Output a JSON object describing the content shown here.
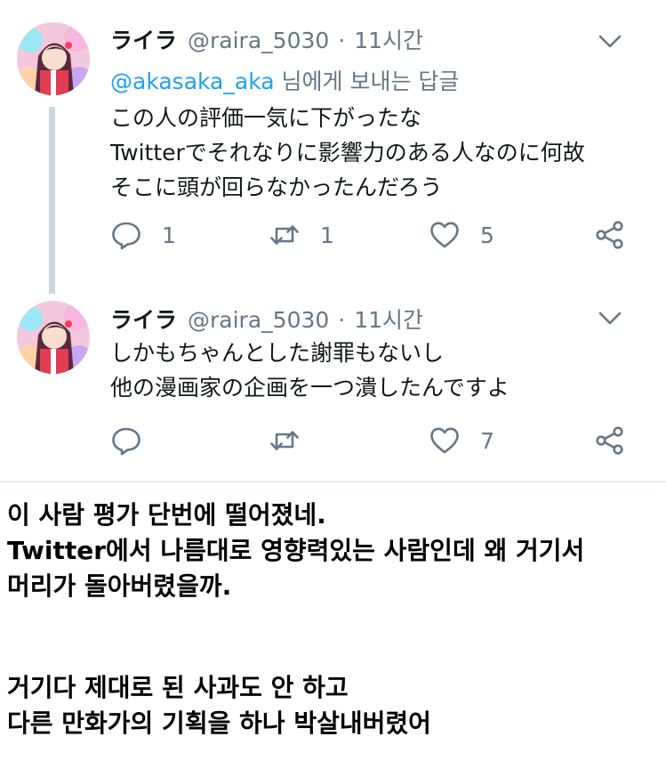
{
  "tweets": [
    {
      "name": "ライラ",
      "handle": "@raira_5030",
      "time": "11시간",
      "reply_to": {
        "handle": "@akasaka_aka",
        "suffix": "님에게 보내는 답글"
      },
      "lines": [
        "この人の評価一気に下がったな",
        "Twitterでそれなりに影響力のある人なのに何故",
        "そこに頭が回らなかったんだろう"
      ],
      "replies": "1",
      "retweets": "1",
      "likes": "5"
    },
    {
      "name": "ライラ",
      "handle": "@raira_5030",
      "time": "11시간",
      "lines": [
        "しかもちゃんとした謝罪もないし",
        "他の漫画家の企画を一つ潰したんですよ"
      ],
      "replies": "",
      "retweets": "",
      "likes": "7"
    }
  ],
  "translation": {
    "block1": [
      "이 사람 평가 단번에 떨어졌네.",
      "Twitter에서 나름대로 영향력있는 사람인데 왜 거기서",
      "머리가 돌아버렸을까."
    ],
    "block2": [
      "거기다 제대로 된 사과도 안 하고",
      "다른 만화가의 기획을 하나 박살내버렸어"
    ]
  },
  "icons": {
    "reply": "reply-icon",
    "retweet": "retweet-icon",
    "like": "heart-icon",
    "share": "share-icon",
    "menu": "chevron-down-icon"
  },
  "colors": {
    "name": "#14171a",
    "secondary": "#657786",
    "link": "#1da1f2",
    "thread_line": "#ccd6dd",
    "icon": "#657786"
  }
}
